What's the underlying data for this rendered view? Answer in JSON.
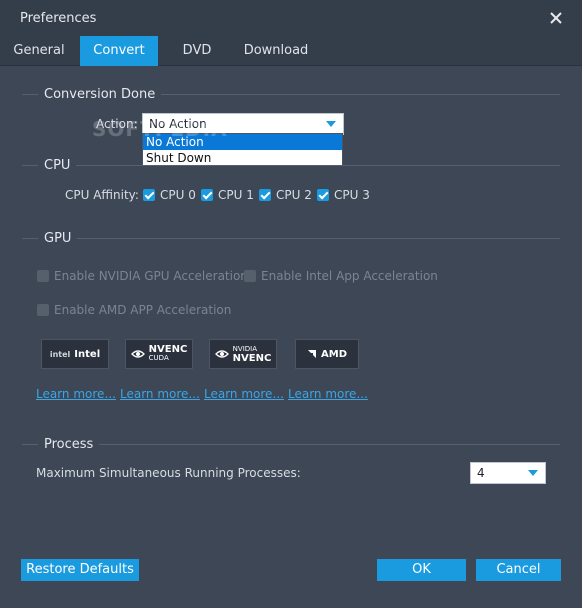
{
  "window": {
    "title": "Preferences"
  },
  "tabs": [
    {
      "label": "General"
    },
    {
      "label": "Convert"
    },
    {
      "label": "DVD"
    },
    {
      "label": "Download"
    }
  ],
  "conversion_done": {
    "section_title": "Conversion Done",
    "action_label": "Action:",
    "action_value": "No Action",
    "options": [
      "No Action",
      "Shut Down"
    ]
  },
  "watermark": "SOFTPEDIA",
  "cpu": {
    "section_title": "CPU",
    "affinity_label": "CPU Affinity:",
    "cores": [
      "CPU 0",
      "CPU 1",
      "CPU 2",
      "CPU 3"
    ]
  },
  "gpu": {
    "section_title": "GPU",
    "options": [
      "Enable NVIDIA GPU Acceleration",
      "Enable Intel App Acceleration",
      "Enable AMD APP Acceleration"
    ],
    "logos": [
      "intel",
      "NVENC",
      "CUDA",
      "NVIDIA",
      "NVENC",
      "AMD"
    ],
    "learn_more": "Learn more..."
  },
  "process": {
    "section_title": "Process",
    "max_label": "Maximum Simultaneous Running Processes:",
    "max_value": "4"
  },
  "buttons": {
    "restore": "Restore Defaults",
    "ok": "OK",
    "cancel": "Cancel"
  },
  "colors": {
    "accent": "#1a9be0",
    "background": "#3d4756",
    "titlebar": "#343d4a"
  }
}
